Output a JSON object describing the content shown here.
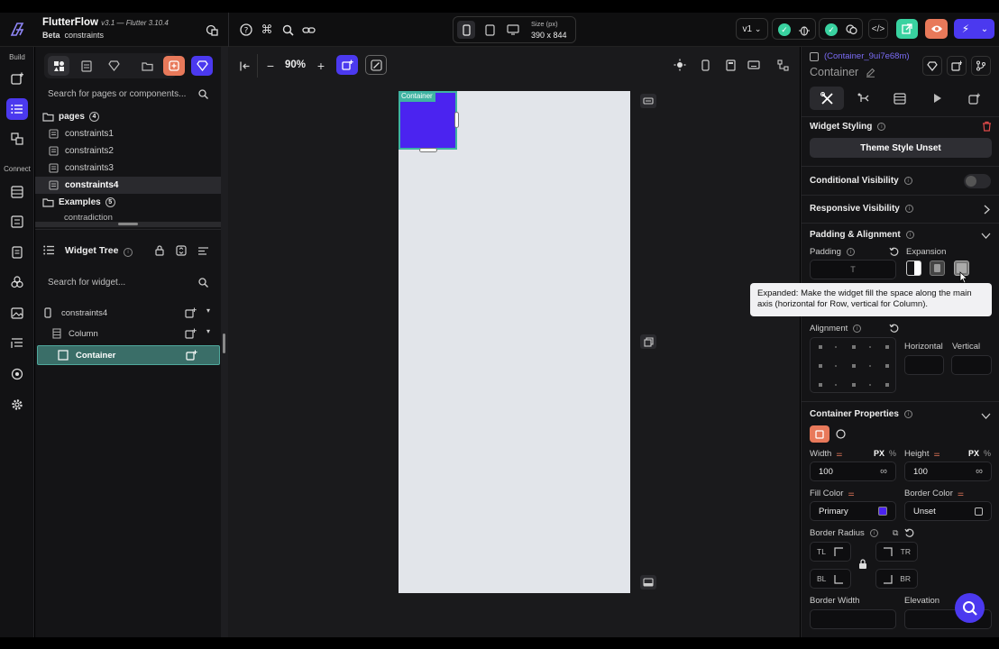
{
  "app": {
    "name": "FlutterFlow",
    "version": "v3.1 — Flutter 3.10.4",
    "channel": "Beta",
    "project": "constraints"
  },
  "device": {
    "size_label": "Size (px)",
    "size_value": "390 x 844"
  },
  "version_select": "v1",
  "rail": {
    "build_label": "Build",
    "connect_label": "Connect"
  },
  "left_panel": {
    "zoom": "90%",
    "search_pages_placeholder": "Search for pages or components...",
    "pages_label": "pages",
    "pages_count": "4",
    "pages": [
      "constraints1",
      "constraints2",
      "constraints3",
      "constraints4"
    ],
    "selected_page": "constraints4",
    "examples_label": "Examples",
    "examples_count": "5",
    "examples_partial": "contradiction",
    "widget_tree_title": "Widget Tree",
    "search_widget_placeholder": "Search for widget...",
    "tree": [
      "constraints4",
      "Column",
      "Container"
    ]
  },
  "canvas": {
    "container_label": "Container"
  },
  "right_panel": {
    "widget_id": "(Container_9ui7e68m)",
    "widget_type": "Container",
    "widget_styling": "Widget Styling",
    "theme_style_button": "Theme Style Unset",
    "conditional_visibility": "Conditional Visibility",
    "responsive_visibility": "Responsive Visibility",
    "padding_alignment": "Padding & Alignment",
    "padding_label": "Padding",
    "padding_top": "T",
    "expansion_label": "Expansion",
    "tooltip": "Expanded: Make the widget fill the space along the main axis (horizontal for Row, vertical for Column).",
    "alignment_label": "Alignment",
    "horizontal_label": "Horizontal",
    "vertical_label": "Vertical",
    "container_properties": "Container Properties",
    "width_label": "Width",
    "height_label": "Height",
    "px_label": "PX",
    "pct_label": "%",
    "width_value": "100",
    "height_value": "100",
    "infinity": "∞",
    "fill_color_label": "Fill Color",
    "fill_color_value": "Primary",
    "border_color_label": "Border Color",
    "border_color_value": "Unset",
    "border_radius_label": "Border Radius",
    "tl": "TL",
    "tr": "TR",
    "bl": "BL",
    "br": "BR",
    "border_width_label": "Border Width",
    "elevation_label": "Elevation"
  },
  "colors": {
    "accent": "#4b39ef",
    "primary_fill": "#4b23f0",
    "selection": "#3fb3a2",
    "green": "#39d2a0",
    "orange": "#e8795a"
  }
}
